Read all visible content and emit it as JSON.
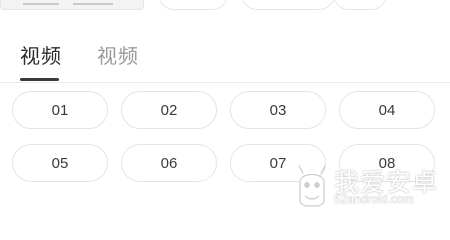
{
  "tabs": [
    {
      "label": "视频",
      "active": true
    },
    {
      "label": "视频",
      "active": false
    }
  ],
  "episodes": [
    "01",
    "02",
    "03",
    "04",
    "05",
    "06",
    "07",
    "08"
  ],
  "watermark": {
    "text": "我爱安卓",
    "url": "52android.com"
  },
  "colors": {
    "active_tab": "#2b2b2b",
    "inactive_tab": "#9a9a9a",
    "pill_border": "#e4e4e4"
  }
}
